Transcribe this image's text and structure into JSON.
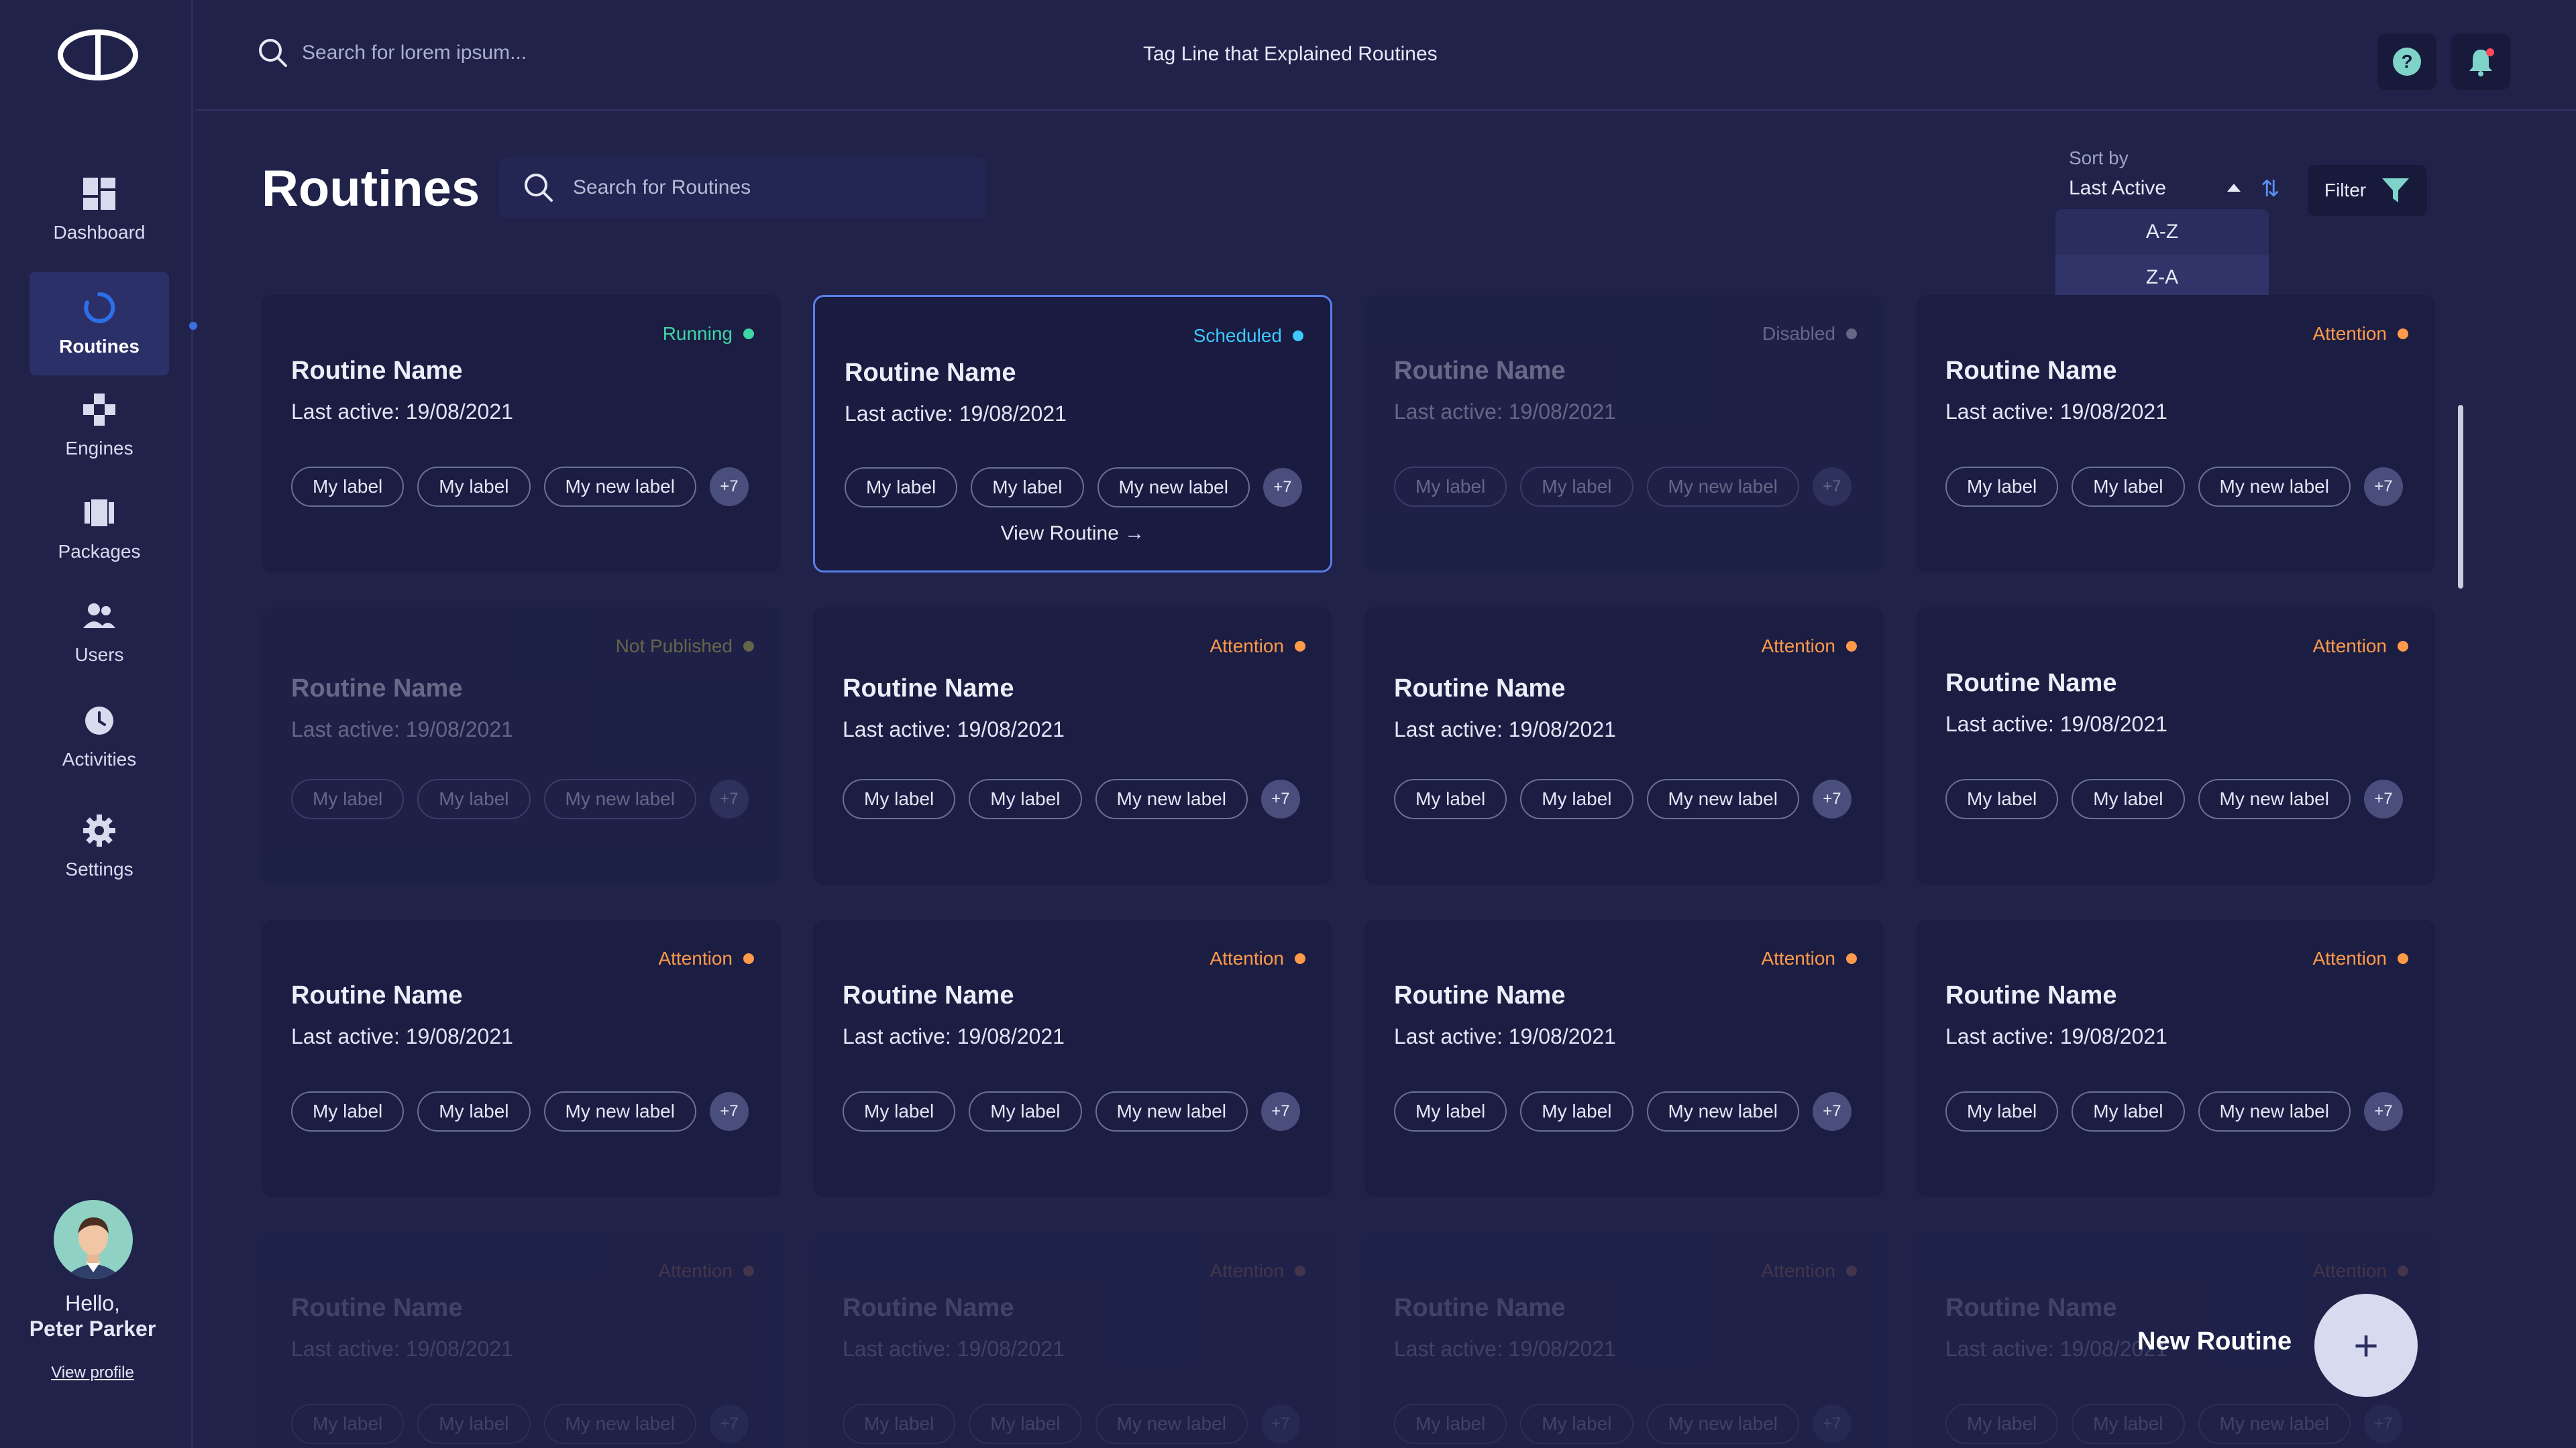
{
  "colors": {
    "background": "#20224a",
    "card": "#1b1d43",
    "running": "#3fd6a6",
    "scheduled": "#3fc8ff",
    "disabled": "#e6e8f5",
    "not_published": "#e6e24a",
    "attention": "#ff9a4a",
    "accent": "#5a8ff0"
  },
  "header": {
    "search_placeholder": "Search for lorem ipsum...",
    "tagline": "Tag Line that Explained Routines"
  },
  "sidebar": {
    "items": [
      {
        "label": "Dashboard",
        "icon": "dashboard-icon"
      },
      {
        "label": "Routines",
        "icon": "routines-icon"
      },
      {
        "label": "Engines",
        "icon": "engines-icon"
      },
      {
        "label": "Packages",
        "icon": "packages-icon"
      },
      {
        "label": "Users",
        "icon": "users-icon"
      },
      {
        "label": "Activities",
        "icon": "clock-icon"
      },
      {
        "label": "Settings",
        "icon": "gear-icon"
      }
    ],
    "user": {
      "greeting": "Hello,",
      "name": "Peter Parker",
      "view_profile": "View profile"
    }
  },
  "main": {
    "title": "Routines",
    "search_placeholder": "Search for Routines",
    "sort": {
      "label": "Sort by",
      "value": "Last Active",
      "options": [
        "A-Z",
        "Z-A"
      ]
    },
    "filter_label": "Filter",
    "new_routine_label": "New Routine",
    "view_routine_label": "View Routine",
    "cards": [
      {
        "status": "Running",
        "name": "Routine Name",
        "last_active": "Last active: 19/08/2021",
        "labels": [
          "My label",
          "My label",
          "My new label"
        ],
        "more": "+7"
      },
      {
        "status": "Scheduled",
        "name": "Routine Name",
        "last_active": "Last active: 19/08/2021",
        "labels": [
          "My label",
          "My label",
          "My new label"
        ],
        "more": "+7"
      },
      {
        "status": "Disabled",
        "name": "Routine Name",
        "last_active": "Last active: 19/08/2021",
        "labels": [
          "My label",
          "My label",
          "My new label"
        ],
        "more": "+7"
      },
      {
        "status": "Attention",
        "name": "Routine Name",
        "last_active": "Last active: 19/08/2021",
        "labels": [
          "My label",
          "My label",
          "My new label"
        ],
        "more": "+7"
      },
      {
        "status": "Not Published",
        "name": "Routine Name",
        "last_active": "Last active: 19/08/2021",
        "labels": [
          "My label",
          "My label",
          "My new label"
        ],
        "more": "+7"
      },
      {
        "status": "Attention",
        "name": "Routine Name",
        "last_active": "Last active: 19/08/2021",
        "labels": [
          "My label",
          "My label",
          "My new label"
        ],
        "more": "+7"
      },
      {
        "status": "Attention",
        "name": "Routine Name",
        "last_active": "Last active: 19/08/2021",
        "labels": [
          "My label",
          "My label",
          "My new label"
        ],
        "more": "+7"
      },
      {
        "status": "Attention",
        "name": "Routine Name",
        "last_active": "Last active: 19/08/2021",
        "labels": [
          "My label",
          "My label",
          "My new label"
        ],
        "more": "+7"
      },
      {
        "status": "Attention",
        "name": "Routine Name",
        "last_active": "Last active: 19/08/2021",
        "labels": [
          "My label",
          "My label",
          "My new label"
        ],
        "more": "+7"
      },
      {
        "status": "Attention",
        "name": "Routine Name",
        "last_active": "Last active: 19/08/2021",
        "labels": [
          "My label",
          "My label",
          "My new label"
        ],
        "more": "+7"
      },
      {
        "status": "Attention",
        "name": "Routine Name",
        "last_active": "Last active: 19/08/2021",
        "labels": [
          "My label",
          "My label",
          "My new label"
        ],
        "more": "+7"
      },
      {
        "status": "Attention",
        "name": "Routine Name",
        "last_active": "Last active: 19/08/2021",
        "labels": [
          "My label",
          "My label",
          "My new label"
        ],
        "more": "+7"
      },
      {
        "status": "Attention",
        "name": "Routine Name",
        "last_active": "Last active: 19/08/2021",
        "labels": [
          "My label",
          "My label",
          "My new label"
        ],
        "more": "+7"
      },
      {
        "status": "Attention",
        "name": "Routine Name",
        "last_active": "Last active: 19/08/2021",
        "labels": [
          "My label",
          "My label",
          "My new label"
        ],
        "more": "+7"
      },
      {
        "status": "Attention",
        "name": "Routine Name",
        "last_active": "Last active: 19/08/2021",
        "labels": [
          "My label",
          "My label",
          "My new label"
        ],
        "more": "+7"
      },
      {
        "status": "Attention",
        "name": "Routine Name",
        "last_active": "Last active: 19/08/2021",
        "labels": [
          "My label",
          "My label",
          "My new label"
        ],
        "more": "+7"
      }
    ]
  }
}
